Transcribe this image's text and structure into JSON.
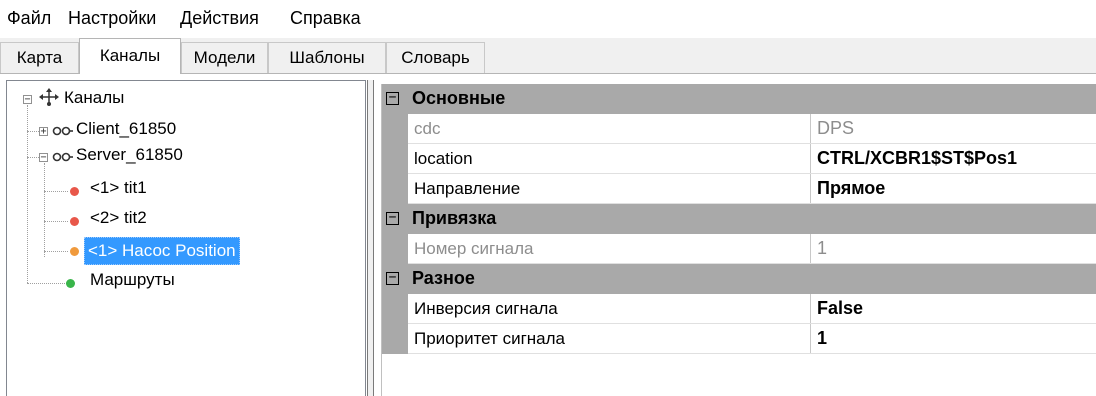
{
  "menu": {
    "items": [
      "Файл",
      "Настройки",
      "Действия",
      "Справка"
    ]
  },
  "tabs": [
    "Карта",
    "Каналы",
    "Модели",
    "Шаблоны",
    "Словарь"
  ],
  "tree": {
    "root": "Каналы",
    "client": "Client_61850",
    "server": "Server_61850",
    "children": [
      "<1> tit1",
      "<2> tit2",
      "<1> Насос Position"
    ],
    "routes": "Маршруты",
    "colors": {
      "red_dot": "#e8574a",
      "orange_dot": "#f09a3c",
      "green_dot": "#39b54a",
      "selection": "#3399ff"
    }
  },
  "properties": {
    "categories": [
      {
        "name": "Основные",
        "rows": [
          {
            "name": "cdc",
            "value": "DPS",
            "disabled": true,
            "bold": false
          },
          {
            "name": "location",
            "value": "CTRL/XCBR1$ST$Pos1",
            "disabled": false,
            "bold": true
          },
          {
            "name": "Направление",
            "value": "Прямое",
            "disabled": false,
            "bold": true
          }
        ]
      },
      {
        "name": "Привязка",
        "rows": [
          {
            "name": "Номер сигнала",
            "value": "1",
            "disabled": true,
            "bold": false
          }
        ]
      },
      {
        "name": "Разное",
        "rows": [
          {
            "name": "Инверсия сигнала",
            "value": "False",
            "disabled": false,
            "bold": true
          },
          {
            "name": "Приоритет сигнала",
            "value": "1",
            "disabled": false,
            "bold": true
          }
        ]
      }
    ],
    "category_color": "#a9a9a9"
  }
}
